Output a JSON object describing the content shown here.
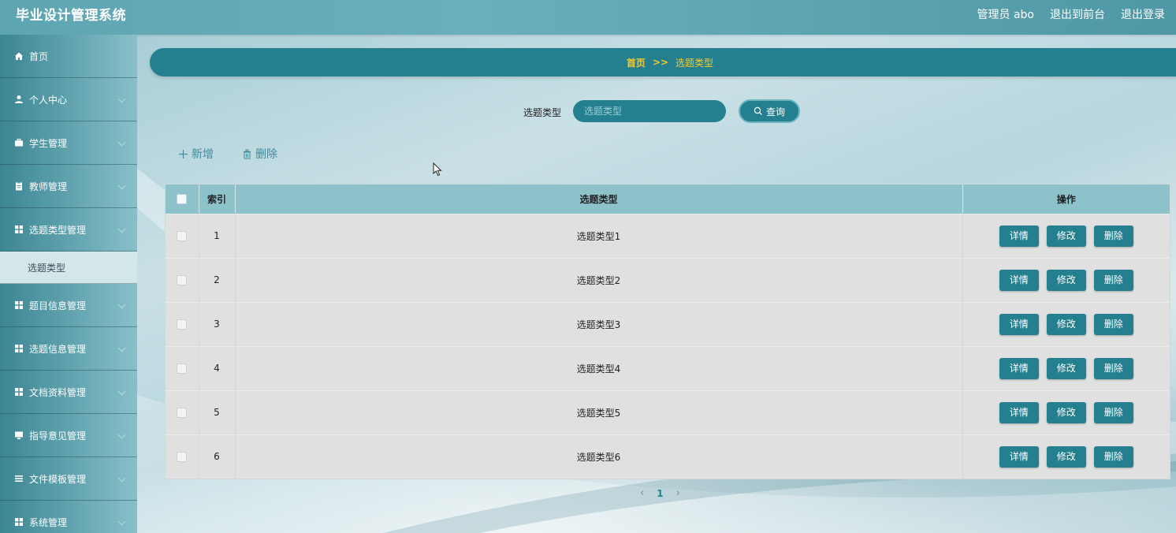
{
  "header": {
    "title": "毕业设计管理系统",
    "user": "管理员 abo",
    "to_front": "退出到前台",
    "logout": "退出登录"
  },
  "sidebar": {
    "items": [
      {
        "label": "首页",
        "icon": "home-icon"
      },
      {
        "label": "个人中心",
        "icon": "user-icon"
      },
      {
        "label": "学生管理",
        "icon": "briefcase-icon"
      },
      {
        "label": "教师管理",
        "icon": "clipboard-icon"
      },
      {
        "label": "选题类型管理",
        "icon": "grid-icon"
      },
      {
        "label": "题目信息管理",
        "icon": "grid-icon"
      },
      {
        "label": "选题信息管理",
        "icon": "grid-icon"
      },
      {
        "label": "文档资料管理",
        "icon": "grid-icon"
      },
      {
        "label": "指导意见管理",
        "icon": "monitor-icon"
      },
      {
        "label": "文件模板管理",
        "icon": "list-icon"
      },
      {
        "label": "系统管理",
        "icon": "grid-icon"
      }
    ],
    "submenu": {
      "label": "选题类型"
    }
  },
  "breadcrumb": {
    "home": "首页",
    "separator": ">>",
    "current": "选题类型"
  },
  "search": {
    "label": "选题类型",
    "placeholder": "选题类型",
    "value": "",
    "button": "查询"
  },
  "actions": {
    "add": "新增",
    "delete": "删除"
  },
  "table": {
    "headers": {
      "index": "索引",
      "type": "选题类型",
      "ops": "操作"
    },
    "rows": [
      {
        "index": "1",
        "type": "选题类型1"
      },
      {
        "index": "2",
        "type": "选题类型2"
      },
      {
        "index": "3",
        "type": "选题类型3"
      },
      {
        "index": "4",
        "type": "选题类型4"
      },
      {
        "index": "5",
        "type": "选题类型5"
      },
      {
        "index": "6",
        "type": "选题类型6"
      }
    ],
    "op_labels": {
      "detail": "详情",
      "edit": "修改",
      "delete": "删除"
    }
  },
  "pagination": {
    "current_page": "1",
    "prev": "‹",
    "next": "›"
  },
  "colors": {
    "primary": "#24808f",
    "accent_text": "#f5c92e",
    "sidebar": "#5fa5b2"
  }
}
